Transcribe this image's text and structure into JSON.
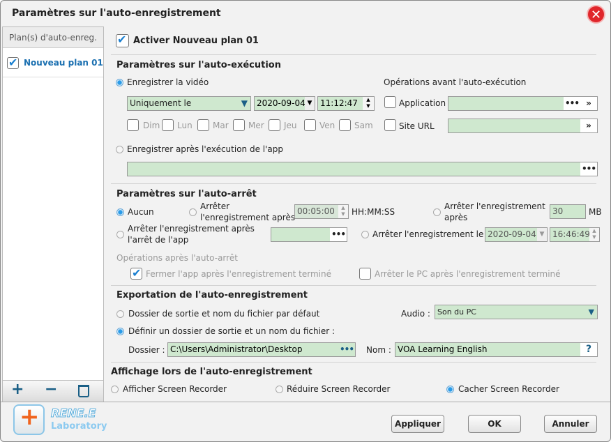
{
  "window": {
    "title": "Paramètres sur l'auto-enregistrement"
  },
  "sidebar": {
    "header": "Plan(s) d'auto-enreg.",
    "items": [
      {
        "label": "Nouveau plan 01",
        "checked": true
      }
    ]
  },
  "enable": {
    "label": "Activer Nouveau plan 01",
    "checked": true
  },
  "autorun": {
    "title": "Paramètres sur l'auto-exécution",
    "record_video": "Enregistrer la vidéo",
    "mode": "Uniquement le",
    "date": "2020-09-04",
    "time": "11:12:47",
    "days": [
      "Dim",
      "Lun",
      "Mar",
      "Mer",
      "Jeu",
      "Ven",
      "Sam"
    ],
    "after_app": "Enregistrer après l'exécution de l'app",
    "ops_title": "Opérations avant l'auto-exécution",
    "application": "Application",
    "site_url": "Site URL"
  },
  "autostop": {
    "title": "Paramètres sur l'auto-arrêt",
    "none": "Aucun",
    "stop_after_1": "Arrêter",
    "stop_after_2": "l'enregistrement après",
    "duration": "00:05:00",
    "duration_unit": "HH:MM:SS",
    "stop_size_1": "Arrêter l'enregistrement",
    "stop_size_2": "après",
    "size": "30",
    "size_unit": "MB",
    "stop_app_1": "Arrêter l'enregistrement après",
    "stop_app_2": "l'arrêt de l'app",
    "stop_at": "Arrêter l'enregistrement le",
    "stop_date": "2020-09-04",
    "stop_time": "16:46:49",
    "ops_title": "Opérations après l'auto-arrêt",
    "close_app": "Fermer l'app après l'enregistrement terminé",
    "shutdown_pc": "Arrêter le PC après l'enregistrement terminé"
  },
  "export": {
    "title": "Exportation de l'auto-enregistrement",
    "default": "Dossier de sortie et nom du fichier par défaut",
    "custom": "Définir un dossier de sortie et un nom du fichier :",
    "audio_label": "Audio :",
    "audio": "Son du PC",
    "folder_label": "Dossier :",
    "folder": "C:\\Users\\Administrator\\Desktop",
    "name_label": "Nom :",
    "name": "VOA Learning English"
  },
  "display": {
    "title": "Affichage lors de l'auto-enregistrement",
    "options": [
      "Afficher Screen Recorder",
      "Réduire Screen Recorder",
      "Cacher Screen Recorder"
    ],
    "selected": 2
  },
  "logo": {
    "brand": "RENE.E",
    "sub": "Laboratory"
  },
  "buttons": {
    "apply": "Appliquer",
    "ok": "OK",
    "cancel": "Annuler"
  },
  "colors": {
    "accent": "#1a7fd0",
    "field": "#cfe8cf",
    "close": "#e0262b"
  }
}
